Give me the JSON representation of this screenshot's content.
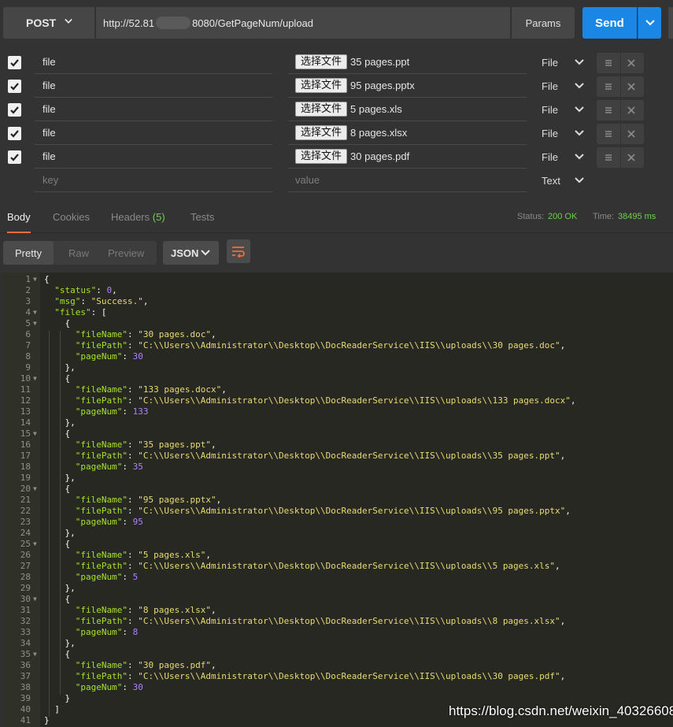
{
  "request": {
    "method": "POST",
    "url_prefix": "http://52.81",
    "url_suffix": "8080/GetPageNum/upload",
    "params_label": "Params",
    "send_label": "Send"
  },
  "form_rows": [
    {
      "key": "file",
      "button": "选择文件",
      "value": "35 pages.ppt",
      "type": "File"
    },
    {
      "key": "file",
      "button": "选择文件",
      "value": "95 pages.pptx",
      "type": "File"
    },
    {
      "key": "file",
      "button": "选择文件",
      "value": "5 pages.xls",
      "type": "File"
    },
    {
      "key": "file",
      "button": "选择文件",
      "value": "8 pages.xlsx",
      "type": "File"
    },
    {
      "key": "file",
      "button": "选择文件",
      "value": "30 pages.pdf",
      "type": "File"
    }
  ],
  "new_row": {
    "key_placeholder": "key",
    "value_placeholder": "value",
    "type": "Text"
  },
  "response_tabs": {
    "body": "Body",
    "cookies": "Cookies",
    "headers": "Headers",
    "headers_count": "(5)",
    "tests": "Tests"
  },
  "response_meta": {
    "status_label": "Status:",
    "status_value": "200 OK",
    "time_label": "Time:",
    "time_value": "38495 ms"
  },
  "view": {
    "pretty": "Pretty",
    "raw": "Raw",
    "preview": "Preview",
    "format": "JSON"
  },
  "code_lines": [
    "{",
    "  \"status\": 0,",
    "  \"msg\": \"Success.\",",
    "  \"files\": [",
    "    {",
    "      \"fileName\": \"30 pages.doc\",",
    "      \"filePath\": \"C:\\\\Users\\\\Administrator\\\\Desktop\\\\DocReaderService\\\\IIS\\\\uploads\\\\30 pages.doc\",",
    "      \"pageNum\": 30",
    "    },",
    "    {",
    "      \"fileName\": \"133 pages.docx\",",
    "      \"filePath\": \"C:\\\\Users\\\\Administrator\\\\Desktop\\\\DocReaderService\\\\IIS\\\\uploads\\\\133 pages.docx\",",
    "      \"pageNum\": 133",
    "    },",
    "    {",
    "      \"fileName\": \"35 pages.ppt\",",
    "      \"filePath\": \"C:\\\\Users\\\\Administrator\\\\Desktop\\\\DocReaderService\\\\IIS\\\\uploads\\\\35 pages.ppt\",",
    "      \"pageNum\": 35",
    "    },",
    "    {",
    "      \"fileName\": \"95 pages.pptx\",",
    "      \"filePath\": \"C:\\\\Users\\\\Administrator\\\\Desktop\\\\DocReaderService\\\\IIS\\\\uploads\\\\95 pages.pptx\",",
    "      \"pageNum\": 95",
    "    },",
    "    {",
    "      \"fileName\": \"5 pages.xls\",",
    "      \"filePath\": \"C:\\\\Users\\\\Administrator\\\\Desktop\\\\DocReaderService\\\\IIS\\\\uploads\\\\5 pages.xls\",",
    "      \"pageNum\": 5",
    "    },",
    "    {",
    "      \"fileName\": \"8 pages.xlsx\",",
    "      \"filePath\": \"C:\\\\Users\\\\Administrator\\\\Desktop\\\\DocReaderService\\\\IIS\\\\uploads\\\\8 pages.xlsx\",",
    "      \"pageNum\": 8",
    "    },",
    "    {",
    "      \"fileName\": \"30 pages.pdf\",",
    "      \"filePath\": \"C:\\\\Users\\\\Administrator\\\\Desktop\\\\DocReaderService\\\\IIS\\\\uploads\\\\30 pages.pdf\",",
    "      \"pageNum\": 30",
    "    }",
    "  ]",
    "}"
  ],
  "fold_lines": [
    1,
    4,
    5,
    10,
    15,
    20,
    25,
    30,
    35
  ],
  "watermark": "https://blog.csdn.net/weixin_40326608",
  "colors": {
    "accent": "#f26b3a",
    "send": "#1a87e6",
    "status_ok": "#6fcf4f"
  }
}
